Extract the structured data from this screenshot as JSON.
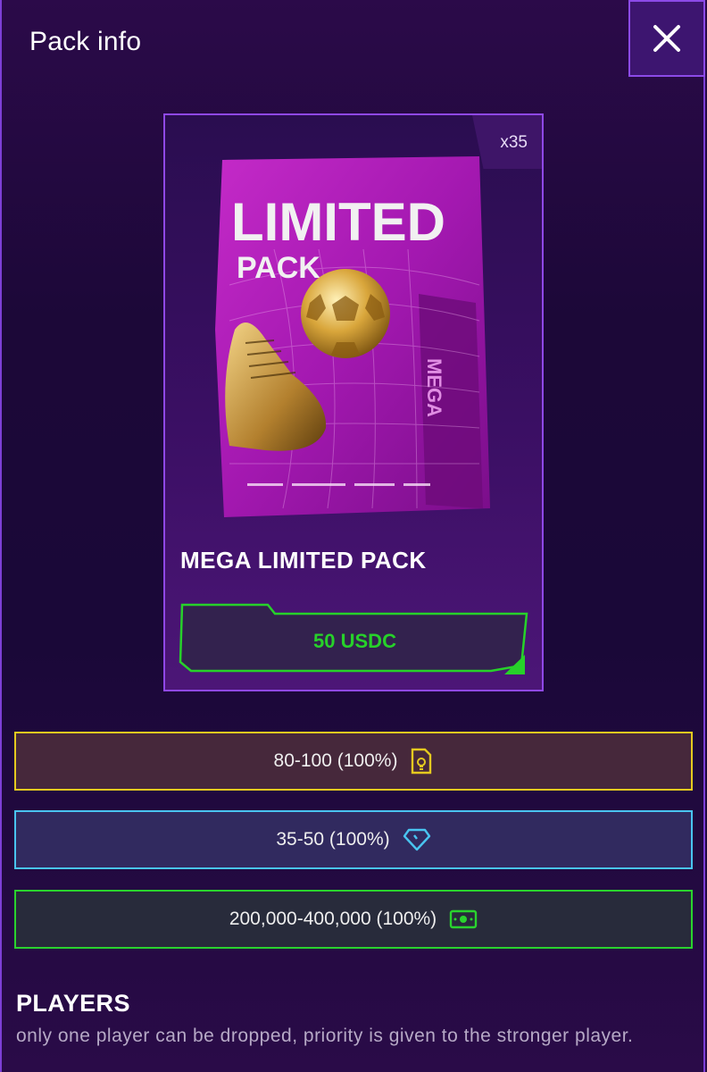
{
  "header": {
    "title": "Pack info",
    "close_icon": "close-icon"
  },
  "pack": {
    "count": "x35",
    "name": "MEGA LIMITED PACK",
    "price": "50 USDC",
    "art": {
      "title_line1": "LIMITED",
      "title_line2": "PACK",
      "side_label": "MEGA"
    }
  },
  "tiers": [
    {
      "label": "80-100 (100%)",
      "icon": "rating-card-icon",
      "color": "#e5ca1f"
    },
    {
      "label": "35-50 (100%)",
      "icon": "diamond-icon",
      "color": "#49c4f0"
    },
    {
      "label": "200,000-400,000 (100%)",
      "icon": "cash-icon",
      "color": "#2ad32e"
    }
  ],
  "players": {
    "heading": "PLAYERS",
    "description": "only one player can be dropped, priority is given to the stronger player."
  }
}
